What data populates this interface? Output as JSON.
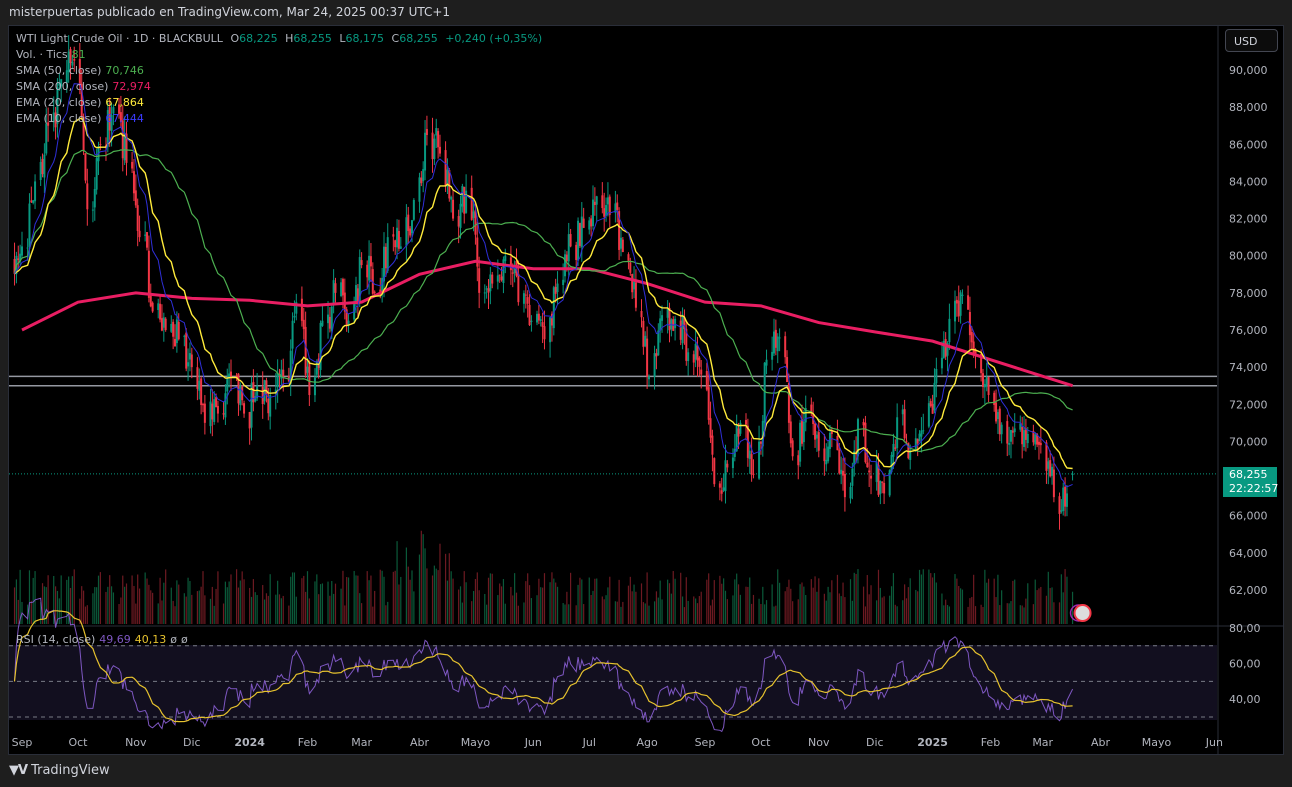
{
  "header": {
    "text": "misterpuertas publicado en TradingView.com, Mar 24, 2025 00:37 UTC+1"
  },
  "legend": {
    "symbol": "WTI Light Crude Oil · 1D · BLACKBULL",
    "o_label": "O",
    "o": "68,225",
    "h_label": "H",
    "h": "68,255",
    "l_label": "L",
    "l": "68,175",
    "c_label": "C",
    "c": "68,255",
    "change": "+0,240 (+0,35%)",
    "vol_label": "Vol. · Tics",
    "vol": "81",
    "sma50_label": "SMA (50, close)",
    "sma50": "70,746",
    "sma200_label": "SMA (200, close)",
    "sma200": "72,974",
    "ema20_label": "EMA (20, close)",
    "ema20": "67,864",
    "ema10_label": "EMA (10, close)",
    "ema10": "67,444",
    "rsi_label": "RSI (14, close)",
    "rsi": "49,69",
    "rsi_ma": "40,13",
    "rsi_extra1": "ø",
    "rsi_extra2": "ø"
  },
  "currency_button": "USD",
  "price_tag": {
    "price": "68,255",
    "countdown": "22:22:57"
  },
  "footer": {
    "brand": "TradingView",
    "logo_icon": "tradingview-logo-icon"
  },
  "colors": {
    "up": "#089981",
    "down": "#f23645",
    "sma50": "#4caf50",
    "sma200": "#e91e63",
    "ema20": "#ffeb3b",
    "ema10": "#2f2fd8",
    "rsi": "#7e57c2",
    "rsi_ma": "#e6c22e"
  },
  "chart_data": {
    "type": "candlestick",
    "title": "WTI Light Crude Oil · 1D · BLACKBULL",
    "start_date": "2023-08-28",
    "weekly_close": [
      80.5,
      84,
      87,
      89.5,
      90.5,
      82.5,
      86,
      88,
      85,
      81,
      77,
      76,
      75.5,
      74,
      71,
      71.5,
      73.5,
      71.5,
      73,
      72.5,
      73.5,
      77.5,
      72.5,
      76.5,
      78,
      76.5,
      79.5,
      78,
      81,
      80.5,
      83,
      86.5,
      85.5,
      82,
      83.5,
      78,
      78.5,
      80,
      77.5,
      76.5,
      75.5,
      78.5,
      80.5,
      81.5,
      83.2,
      82.2,
      80.2,
      77.2,
      73.5,
      76.8,
      76.6,
      74.8,
      73.6,
      67.7,
      68.6,
      71,
      68.2,
      74.4,
      75.6,
      69.2,
      71.8,
      69.5,
      70.4,
      67,
      71.2,
      68,
      67.2,
      71.3,
      69.5,
      70.6,
      73.9,
      76.6,
      77.9,
      74.7,
      72.5,
      70.9,
      70.7,
      70.4,
      69.8,
      67,
      67.2,
      68.255
    ],
    "sma200_monthly": [
      76,
      77.5,
      78,
      77.7,
      77.6,
      77.3,
      77.5,
      79,
      79.7,
      79.3,
      79.3,
      78.5,
      77.5,
      77.3,
      76.4,
      75.9,
      75.4,
      74.4,
      73.0
    ],
    "horizontal_levels": [
      73.0,
      73.5
    ],
    "last_price": 68.255,
    "price_ticks": [
      "62,000",
      "64,000",
      "66,000",
      "68,000",
      "70,000",
      "72,000",
      "74,000",
      "76,000",
      "78,000",
      "80,000",
      "82,000",
      "84,000",
      "86,000",
      "88,000",
      "90,000"
    ],
    "price_tick_values": [
      62,
      64,
      66,
      68,
      70,
      72,
      74,
      76,
      78,
      80,
      82,
      84,
      86,
      88,
      90
    ],
    "ylim": [
      62,
      90
    ],
    "rsi_ticks": [
      "40,00",
      "60,00",
      "80,00"
    ],
    "rsi_tick_values": [
      40,
      60,
      80
    ],
    "rsi_levels": [
      70,
      50,
      30
    ],
    "x_ticks": [
      {
        "label": "Sep",
        "date": "2023-09-01"
      },
      {
        "label": "Oct",
        "date": "2023-10-01"
      },
      {
        "label": "Nov",
        "date": "2023-11-01"
      },
      {
        "label": "Dic",
        "date": "2023-12-01"
      },
      {
        "label": "2024",
        "date": "2024-01-01"
      },
      {
        "label": "Feb",
        "date": "2024-02-01"
      },
      {
        "label": "Mar",
        "date": "2024-03-01"
      },
      {
        "label": "Abr",
        "date": "2024-04-01"
      },
      {
        "label": "Mayo",
        "date": "2024-05-01"
      },
      {
        "label": "Jun",
        "date": "2024-06-01"
      },
      {
        "label": "Jul",
        "date": "2024-07-01"
      },
      {
        "label": "Ago",
        "date": "2024-08-01"
      },
      {
        "label": "Sep",
        "date": "2024-09-01"
      },
      {
        "label": "Oct",
        "date": "2024-10-01"
      },
      {
        "label": "Nov",
        "date": "2024-11-01"
      },
      {
        "label": "Dic",
        "date": "2024-12-01"
      },
      {
        "label": "2025",
        "date": "2025-01-01"
      },
      {
        "label": "Feb",
        "date": "2025-02-01"
      },
      {
        "label": "Mar",
        "date": "2025-03-01"
      },
      {
        "label": "Abr",
        "date": "2025-04-01"
      },
      {
        "label": "Mayo",
        "date": "2025-05-01"
      },
      {
        "label": "Jun",
        "date": "2025-06-01"
      }
    ]
  }
}
